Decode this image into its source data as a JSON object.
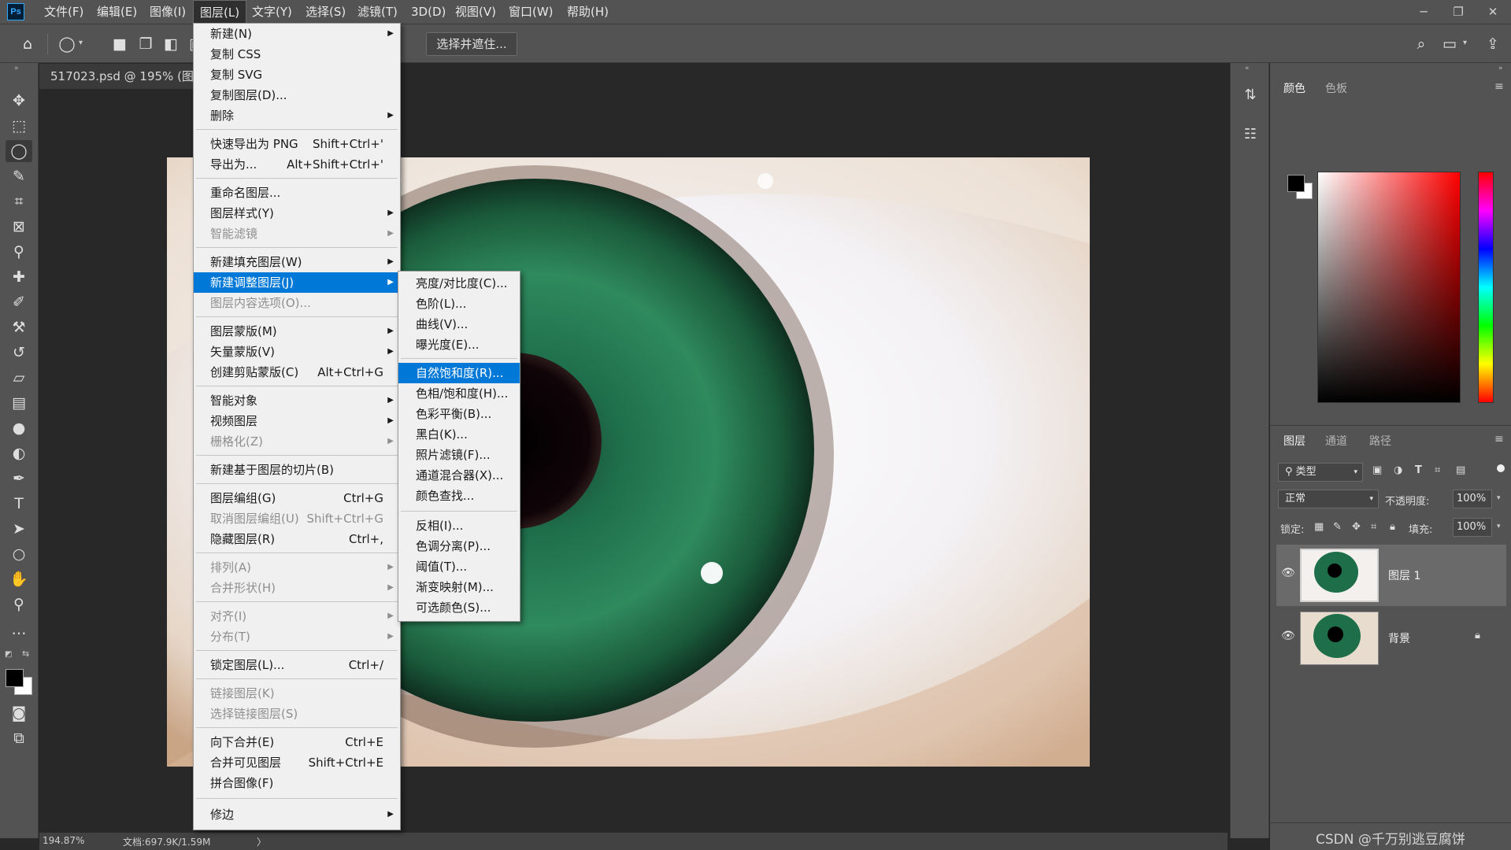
{
  "app": {
    "logo": "Ps",
    "menus": [
      "文件(F)",
      "编辑(E)",
      "图像(I)",
      "图层(L)",
      "文字(Y)",
      "选择(S)",
      "滤镜(T)",
      "3D(D)",
      "视图(V)",
      "窗口(W)",
      "帮助(H)"
    ],
    "window_controls": [
      "─",
      "❐",
      "✕"
    ]
  },
  "options": {
    "select_and_mask": "选择并遮住..."
  },
  "document": {
    "tab_title": "517023.psd @ 195% (图层",
    "zoom": "194.87%",
    "doc_size": "文档:697.9K/1.59M",
    "status_arrow": "〉"
  },
  "layer_menu": {
    "items": [
      {
        "label": "新建(N)",
        "shortcut": "",
        "submenu": true,
        "disabled": false
      },
      {
        "label": "复制 CSS",
        "shortcut": "",
        "submenu": false,
        "disabled": false
      },
      {
        "label": "复制 SVG",
        "shortcut": "",
        "submenu": false,
        "disabled": false
      },
      {
        "label": "复制图层(D)...",
        "shortcut": "",
        "submenu": false,
        "disabled": false
      },
      {
        "label": "删除",
        "shortcut": "",
        "submenu": true,
        "disabled": false
      },
      {
        "label": "快速导出为 PNG",
        "shortcut": "Shift+Ctrl+'",
        "submenu": false,
        "disabled": false
      },
      {
        "label": "导出为...",
        "shortcut": "Alt+Shift+Ctrl+'",
        "submenu": false,
        "disabled": false
      },
      {
        "label": "重命名图层...",
        "shortcut": "",
        "submenu": false,
        "disabled": false
      },
      {
        "label": "图层样式(Y)",
        "shortcut": "",
        "submenu": true,
        "disabled": false
      },
      {
        "label": "智能滤镜",
        "shortcut": "",
        "submenu": true,
        "disabled": true
      },
      {
        "label": "新建填充图层(W)",
        "shortcut": "",
        "submenu": true,
        "disabled": false
      },
      {
        "label": "新建调整图层(J)",
        "shortcut": "",
        "submenu": true,
        "disabled": false,
        "highlighted": true
      },
      {
        "label": "图层内容选项(O)...",
        "shortcut": "",
        "submenu": false,
        "disabled": true
      },
      {
        "label": "图层蒙版(M)",
        "shortcut": "",
        "submenu": true,
        "disabled": false
      },
      {
        "label": "矢量蒙版(V)",
        "shortcut": "",
        "submenu": true,
        "disabled": false
      },
      {
        "label": "创建剪贴蒙版(C)",
        "shortcut": "Alt+Ctrl+G",
        "submenu": false,
        "disabled": false
      },
      {
        "label": "智能对象",
        "shortcut": "",
        "submenu": true,
        "disabled": false
      },
      {
        "label": "视频图层",
        "shortcut": "",
        "submenu": true,
        "disabled": false
      },
      {
        "label": "栅格化(Z)",
        "shortcut": "",
        "submenu": true,
        "disabled": true
      },
      {
        "label": "新建基于图层的切片(B)",
        "shortcut": "",
        "submenu": false,
        "disabled": false
      },
      {
        "label": "图层编组(G)",
        "shortcut": "Ctrl+G",
        "submenu": false,
        "disabled": false
      },
      {
        "label": "取消图层编组(U)",
        "shortcut": "Shift+Ctrl+G",
        "submenu": false,
        "disabled": true
      },
      {
        "label": "隐藏图层(R)",
        "shortcut": "Ctrl+,",
        "submenu": false,
        "disabled": false
      },
      {
        "label": "排列(A)",
        "shortcut": "",
        "submenu": true,
        "disabled": true
      },
      {
        "label": "合并形状(H)",
        "shortcut": "",
        "submenu": true,
        "disabled": true
      },
      {
        "label": "对齐(I)",
        "shortcut": "",
        "submenu": true,
        "disabled": true
      },
      {
        "label": "分布(T)",
        "shortcut": "",
        "submenu": true,
        "disabled": true
      },
      {
        "label": "锁定图层(L)...",
        "shortcut": "Ctrl+/",
        "submenu": false,
        "disabled": false
      },
      {
        "label": "链接图层(K)",
        "shortcut": "",
        "submenu": false,
        "disabled": true
      },
      {
        "label": "选择链接图层(S)",
        "shortcut": "",
        "submenu": false,
        "disabled": true
      },
      {
        "label": "向下合并(E)",
        "shortcut": "Ctrl+E",
        "submenu": false,
        "disabled": false
      },
      {
        "label": "合并可见图层",
        "shortcut": "Shift+Ctrl+E",
        "submenu": false,
        "disabled": false
      },
      {
        "label": "拼合图像(F)",
        "shortcut": "",
        "submenu": false,
        "disabled": false
      },
      {
        "label": "修边",
        "shortcut": "",
        "submenu": true,
        "disabled": false
      }
    ]
  },
  "adjust_submenu": {
    "items": [
      {
        "label": "亮度/对比度(C)..."
      },
      {
        "label": "色阶(L)..."
      },
      {
        "label": "曲线(V)..."
      },
      {
        "label": "曝光度(E)..."
      },
      {
        "label": "自然饱和度(R)...",
        "highlighted": true
      },
      {
        "label": "色相/饱和度(H)..."
      },
      {
        "label": "色彩平衡(B)..."
      },
      {
        "label": "黑白(K)..."
      },
      {
        "label": "照片滤镜(F)..."
      },
      {
        "label": "通道混合器(X)..."
      },
      {
        "label": "颜色查找..."
      },
      {
        "label": "反相(I)..."
      },
      {
        "label": "色调分离(P)..."
      },
      {
        "label": "阈值(T)..."
      },
      {
        "label": "渐变映射(M)..."
      },
      {
        "label": "可选颜色(S)..."
      }
    ]
  },
  "panels": {
    "color_tabs": [
      "颜色",
      "色板"
    ],
    "layer_tabs": [
      "图层",
      "通道",
      "路径"
    ],
    "filter_kind": "类型",
    "blend_mode": "正常",
    "opacity_label": "不透明度:",
    "opacity_value": "100%",
    "lock_label": "锁定:",
    "fill_label": "填充:",
    "fill_value": "100%",
    "layers": [
      {
        "name": "图层 1",
        "selected": true
      },
      {
        "name": "背景",
        "locked": true
      }
    ]
  },
  "watermark": "CSDN @千万别逃豆腐饼",
  "colors": {
    "ui_bg": "#535353",
    "canvas_bg": "#282828",
    "menu_bg": "#f0f0f0",
    "highlight": "#0078d7",
    "iris": "#1e6e4a"
  }
}
